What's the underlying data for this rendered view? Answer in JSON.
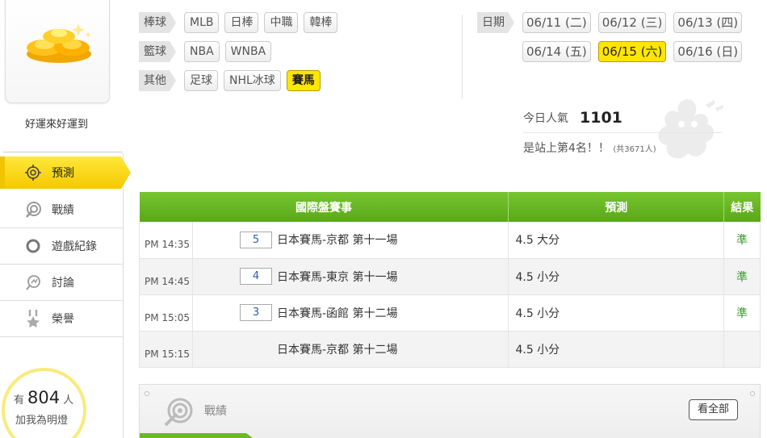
{
  "sidebar": {
    "username": "好運來好運到",
    "nav": [
      {
        "label": "預測",
        "icon": "target-icon",
        "active": true
      },
      {
        "label": "戰績",
        "icon": "record-icon",
        "active": false
      },
      {
        "label": "遊戲紀錄",
        "icon": "circle-icon",
        "active": false
      },
      {
        "label": "討論",
        "icon": "chat-icon",
        "active": false
      },
      {
        "label": "榮譽",
        "icon": "medal-icon",
        "active": false
      }
    ],
    "lamp": {
      "prefix": "有",
      "count": "804",
      "suffix": "人",
      "line2": "加我為明燈"
    }
  },
  "filters": [
    {
      "label": "棒球",
      "items": [
        "MLB",
        "日棒",
        "中職",
        "韓棒"
      ]
    },
    {
      "label": "籃球",
      "items": [
        "NBA",
        "WNBA"
      ]
    },
    {
      "label": "其他",
      "items": [
        "足球",
        "NHL冰球",
        "賽馬"
      ],
      "active_index": 2
    }
  ],
  "dates": {
    "label": "日期",
    "row1": [
      "06/11 (二)",
      "06/12 (三)",
      "06/13 (四)"
    ],
    "row2": [
      "06/14 (五)",
      "06/15 (六)",
      "06/16 (日)"
    ],
    "active": "06/15 (六)"
  },
  "popularity": {
    "label": "今日人氣",
    "value": "1101",
    "rank_text": "是站上第4名！！",
    "total_text": "(共3671人)"
  },
  "table": {
    "headers": [
      "國際盤賽事",
      "預測",
      "結果"
    ],
    "rows": [
      {
        "time": "PM 14:35",
        "num": "5",
        "match": "日本賽馬-京都 第十一場",
        "pred": "4.5 大分",
        "result": "準"
      },
      {
        "time": "PM 14:45",
        "num": "4",
        "match": "日本賽馬-東京 第十一場",
        "pred": "4.5 小分",
        "result": "準"
      },
      {
        "time": "PM 15:05",
        "num": "3",
        "match": "日本賽馬-函館 第十二場",
        "pred": "4.5 小分",
        "result": "準"
      },
      {
        "time": "PM 15:15",
        "num": "",
        "match": "日本賽馬-京都 第十二場",
        "pred": "4.5 小分",
        "result": ""
      }
    ]
  },
  "record_panel": {
    "title": "戰績",
    "view_all": "看全部"
  },
  "colors": {
    "accent_yellow": "#ffe600",
    "green": "#6ab824",
    "result_green": "#3a9a30"
  }
}
